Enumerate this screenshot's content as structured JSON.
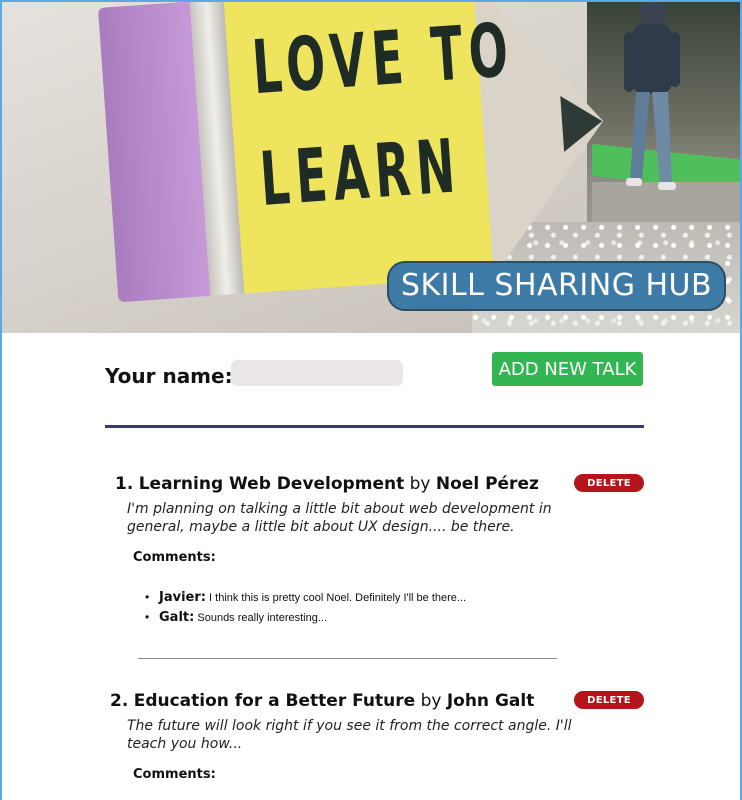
{
  "hero": {
    "sign_line1": "LOVE TO",
    "sign_line2": "LEARN",
    "badge_text": "SKILL SHARING HUB"
  },
  "form": {
    "name_label": "Your name:",
    "name_value": "",
    "add_button_label": "ADD NEW TALK"
  },
  "talks": [
    {
      "number": "1.",
      "title": "Learning Web Development",
      "by": "by",
      "author": "Noel Pérez",
      "delete_label": "DELETE",
      "summary": "I'm planning on talking a little bit about web development in general, maybe a little bit about UX design.... be there.",
      "comments_label": "Comments:",
      "comments": [
        {
          "author": "Javier:",
          "text": "I think this is pretty cool Noel. Definitely I'll be there..."
        },
        {
          "author": "Galt:",
          "text": "Sounds really interesting..."
        }
      ]
    },
    {
      "number": "2.",
      "title": "Education for a Better Future",
      "by": "by",
      "author": "John Galt",
      "delete_label": "DELETE",
      "summary": "The future will look right if you see it from the correct angle. I'll teach you how...",
      "comments_label": "Comments:",
      "comments": []
    }
  ],
  "colors": {
    "badge_bg": "#3e7aa6",
    "add_button_bg": "#34b553",
    "delete_button_bg": "#b5141b",
    "divider": "#3b3a6e"
  }
}
